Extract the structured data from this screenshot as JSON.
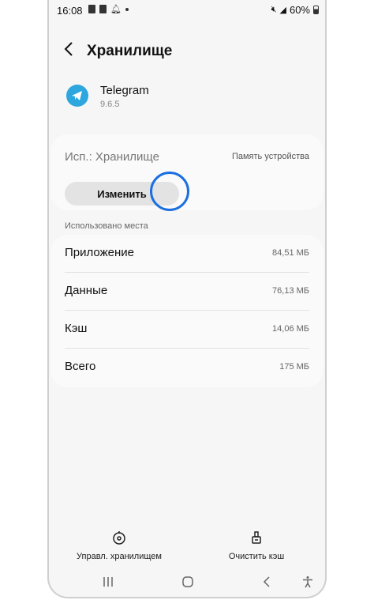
{
  "status": {
    "time": "16:08",
    "battery": "60%"
  },
  "header": {
    "back_icon": "chevron-left-icon",
    "title": "Хранилище"
  },
  "app": {
    "name": "Telegram",
    "version": "9.6.5",
    "icon": "telegram-icon",
    "brand_color": "#2ea6de"
  },
  "storage": {
    "used_label": "Исп.: Хранилище",
    "device_label": "Память устройства",
    "change_button": "Изменить"
  },
  "usage": {
    "section_label": "Использовано места",
    "rows": [
      {
        "label": "Приложение",
        "value": "84,51 МБ"
      },
      {
        "label": "Данные",
        "value": "76,13 МБ"
      },
      {
        "label": "Кэш",
        "value": "14,06 МБ"
      },
      {
        "label": "Всего",
        "value": "175 МБ"
      }
    ]
  },
  "actions": {
    "manage_label": "Управл. хранилищем",
    "clear_cache_label": "Очистить кэш"
  },
  "accent_color": "#1b6fe0"
}
